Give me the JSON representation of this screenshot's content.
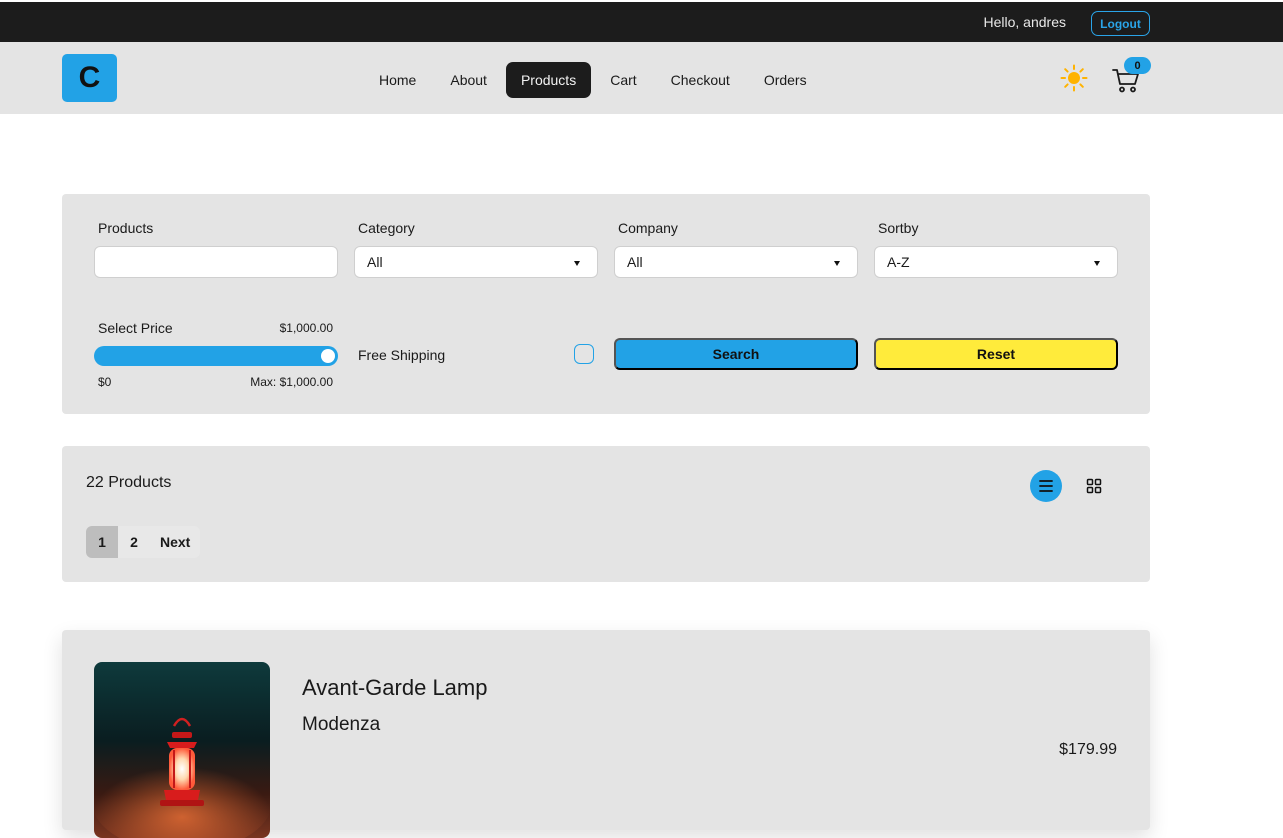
{
  "topbar": {
    "greeting": "Hello, andres",
    "logout_label": "Logout"
  },
  "navbar": {
    "logo_text": "C",
    "links": [
      {
        "label": "Home",
        "active": false
      },
      {
        "label": "About",
        "active": false
      },
      {
        "label": "Products",
        "active": true
      },
      {
        "label": "Cart",
        "active": false
      },
      {
        "label": "Checkout",
        "active": false
      },
      {
        "label": "Orders",
        "active": false
      }
    ],
    "theme_icon": "sun-icon",
    "cart_icon": "shopping-cart-icon",
    "cart_count": "0"
  },
  "filters": {
    "search_label": "Products",
    "search_value": "",
    "category_label": "Category",
    "category_value": "All",
    "company_label": "Company",
    "company_value": "All",
    "sort_label": "Sortby",
    "sort_value": "A-Z",
    "price_label": "Select Price",
    "price_current": "$1,000.00",
    "price_min": "$0",
    "price_max": "Max: $1,000.00",
    "price_level": 1.0,
    "shipping_label": "Free Shipping",
    "shipping_checked": false,
    "search_button": "Search",
    "reset_button": "Reset"
  },
  "results": {
    "count_text": "22 Products",
    "list_view_icon": "list-view-icon",
    "grid_view_icon": "grid-view-icon",
    "pages": [
      "1",
      "2"
    ],
    "current_page": "1",
    "next_label": "Next"
  },
  "product": {
    "name": "Avant-Garde Lamp",
    "company": "Modenza",
    "price": "$179.99"
  },
  "colors": {
    "accent": "#22a2e6",
    "dark": "#1c1c1c",
    "reset": "#ffeb3b",
    "panel": "#e4e4e4"
  }
}
